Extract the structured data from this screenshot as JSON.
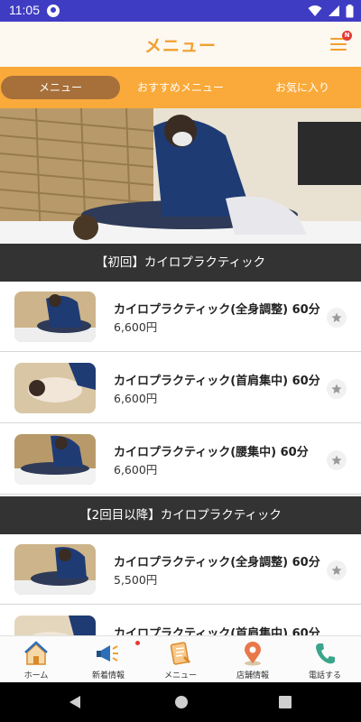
{
  "status": {
    "time": "11:05"
  },
  "header": {
    "title": "メニュー",
    "notification_badge": "N"
  },
  "tabs": [
    {
      "label": "メニュー",
      "active": true
    },
    {
      "label": "おすすめメニュー",
      "active": false
    },
    {
      "label": "お気に入り",
      "active": false
    }
  ],
  "sections": [
    {
      "title": "【初回】カイロプラクティック",
      "items": [
        {
          "name": "カイロプラクティック(全身調整) 60分",
          "price": "6,600円"
        },
        {
          "name": "カイロプラクティック(首肩集中) 60分",
          "price": "6,600円"
        },
        {
          "name": "カイロプラクティック(腰集中) 60分",
          "price": "6,600円"
        }
      ]
    },
    {
      "title": "【2回目以降】カイロプラクティック",
      "items": [
        {
          "name": "カイロプラクティック(全身調整) 60分",
          "price": "5,500円"
        },
        {
          "name": "カイロプラクティック(首肩集中) 60分",
          "price": ""
        }
      ]
    }
  ],
  "bottom_nav": [
    {
      "label": "ホーム",
      "icon": "home-icon"
    },
    {
      "label": "新着情報",
      "icon": "megaphone-icon"
    },
    {
      "label": "メニュー",
      "icon": "menu-book-icon"
    },
    {
      "label": "店舗情報",
      "icon": "map-pin-icon"
    },
    {
      "label": "電話する",
      "icon": "phone-icon"
    }
  ],
  "colors": {
    "status_bar": "#3f3cc4",
    "accent_orange": "#f9aa3a",
    "active_tab": "#a7703a",
    "section_header": "#333333"
  }
}
